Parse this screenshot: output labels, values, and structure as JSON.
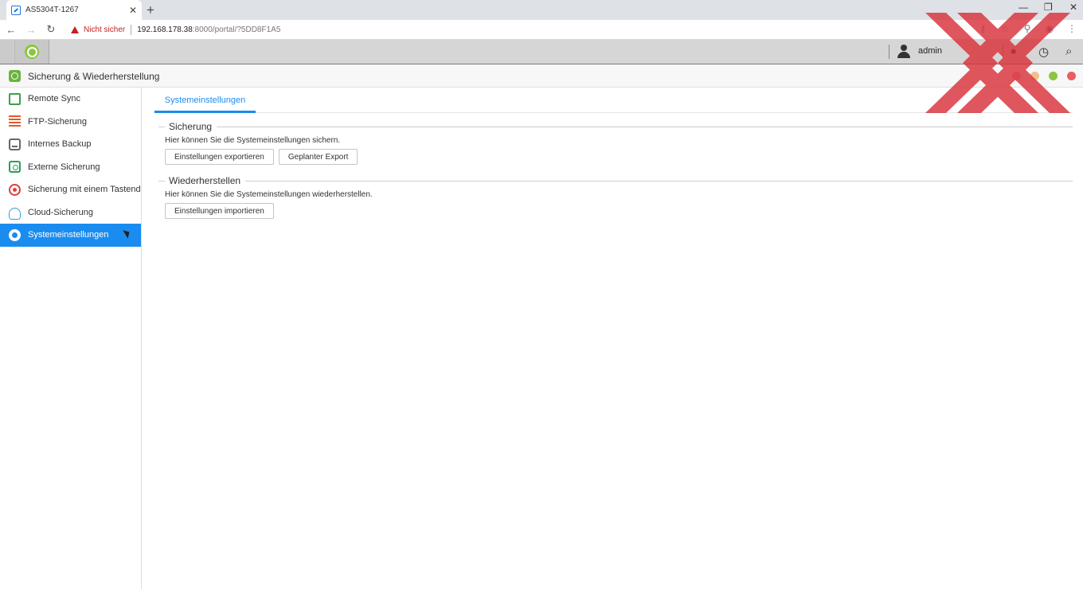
{
  "browser": {
    "tab_title": "AS5304T-1267",
    "security_label": "Nicht sicher",
    "url_host": "192.168.178.38",
    "url_rest": ":8000/portal/?5DD8F1A5"
  },
  "header": {
    "user": "admin"
  },
  "window": {
    "title": "Sicherung & Wiederherstellung",
    "dot_colors": [
      "#e9a9a9",
      "#f0c08a",
      "#8cc63f",
      "#e85f5f"
    ]
  },
  "sidebar": {
    "items": [
      {
        "label": "Remote Sync",
        "icon": "remote-sync-icon"
      },
      {
        "label": "FTP-Sicherung",
        "icon": "ftp-icon"
      },
      {
        "label": "Internes Backup",
        "icon": "internal-backup-icon"
      },
      {
        "label": "Externe Sicherung",
        "icon": "external-backup-icon"
      },
      {
        "label": "Sicherung mit einem Tastendruck",
        "icon": "one-touch-icon"
      },
      {
        "label": "Cloud-Sicherung",
        "icon": "cloud-icon"
      },
      {
        "label": "Systemeinstellungen",
        "icon": "gear-icon",
        "active": true
      }
    ]
  },
  "main": {
    "tab": "Systemeinstellungen",
    "backup": {
      "title": "Sicherung",
      "description": "Hier können Sie die Systemeinstellungen sichern.",
      "export_button": "Einstellungen exportieren",
      "scheduled_button": "Geplanter Export"
    },
    "restore": {
      "title": "Wiederherstellen",
      "description": "Hier können Sie die Systemeinstellungen wiederherstellen.",
      "import_button": "Einstellungen importieren"
    }
  },
  "colors": {
    "accent": "#1a8cf0",
    "watermark": "#d9323b"
  }
}
